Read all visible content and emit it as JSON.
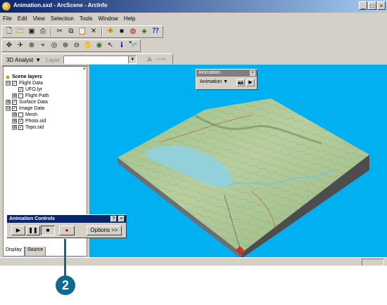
{
  "app": {
    "title": "Animation.sxd - ArcScene - ArcInfo"
  },
  "window_buttons": [
    "_",
    "□",
    "×"
  ],
  "menu": [
    "File",
    "Edit",
    "View",
    "Selection",
    "Tools",
    "Window",
    "Help"
  ],
  "toolbar3": {
    "analyst_label": "3D Analyst",
    "layer_label": "Layer:"
  },
  "toc": {
    "root": "Scene layers",
    "items": [
      {
        "label": "Flight Data",
        "expand": "⊟",
        "checked": true
      },
      {
        "label": "UFO.lyr",
        "checked": true
      },
      {
        "label": "Flight Path",
        "expand": "⊞",
        "checked": false
      },
      {
        "label": "Surface Data",
        "expand": "⊞",
        "checked": true
      },
      {
        "label": "Image Data",
        "expand": "⊟",
        "checked": true
      },
      {
        "label": "Mesh",
        "expand": "⊞",
        "checked": false
      },
      {
        "label": "Photo.sid",
        "expand": "⊞",
        "checked": true
      },
      {
        "label": "Topo.sid",
        "expand": "⊞",
        "checked": true
      }
    ],
    "tabs": [
      "Display",
      "Source"
    ]
  },
  "animation_toolbar": {
    "title": "Animation",
    "menu_label": "Animation ▼"
  },
  "animation_controls": {
    "title": "Animation Controls",
    "help": "?",
    "close": "×",
    "options_label": "Options >>"
  },
  "callout": {
    "number": "2"
  },
  "colors": {
    "scene_bg": "#00b0f0",
    "title_bar": "#0a246a",
    "callout": "#0f6b8e"
  }
}
